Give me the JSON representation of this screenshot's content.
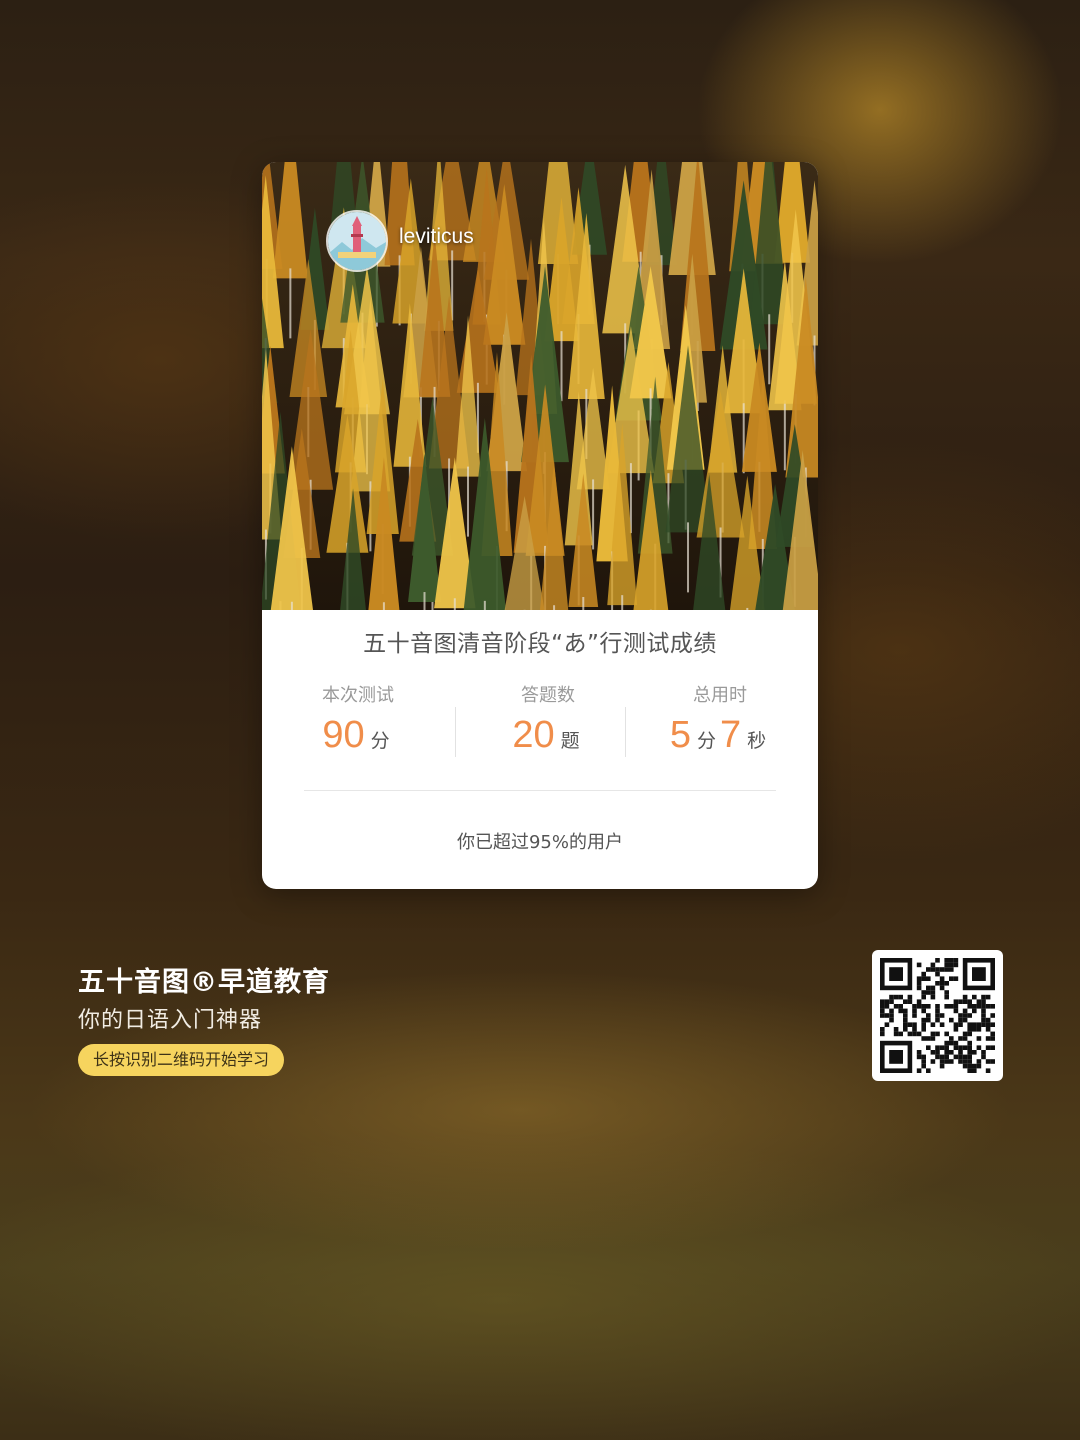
{
  "card": {
    "username": "leviticus",
    "title": "五十音图清音阶段“あ”行测试成绩",
    "stats": [
      {
        "label": "本次测试",
        "value": "90",
        "unit": "分"
      },
      {
        "label": "答题数",
        "value": "20",
        "unit": "题"
      },
      {
        "label": "总用时",
        "minutes": "5",
        "minutes_unit": "分",
        "seconds": "7",
        "seconds_unit": "秒"
      }
    ],
    "beat_text": "你已超过95%的用户"
  },
  "promo": {
    "title": "五十音图®早道教育",
    "subtitle": "你的日语入门神器",
    "cta": "长按识别二维码开始学习"
  },
  "colors": {
    "accent": "#f08d4a",
    "pill": "#f6d45e"
  }
}
